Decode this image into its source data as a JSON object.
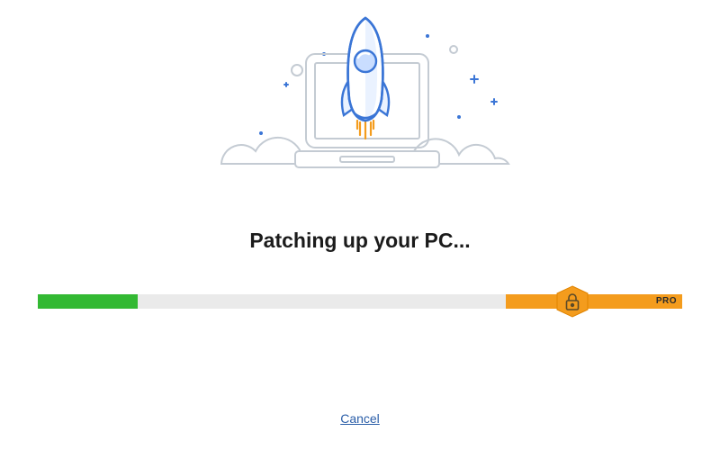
{
  "title": "Patching up your PC...",
  "progress": {
    "fill_percent": 15.5,
    "pro_section_percent": 27.4,
    "pro_label": "PRO"
  },
  "cancel_label": "Cancel",
  "colors": {
    "green": "#33b933",
    "orange": "#f49c1d",
    "track": "#eaeaea",
    "link": "#2b5ea8"
  }
}
